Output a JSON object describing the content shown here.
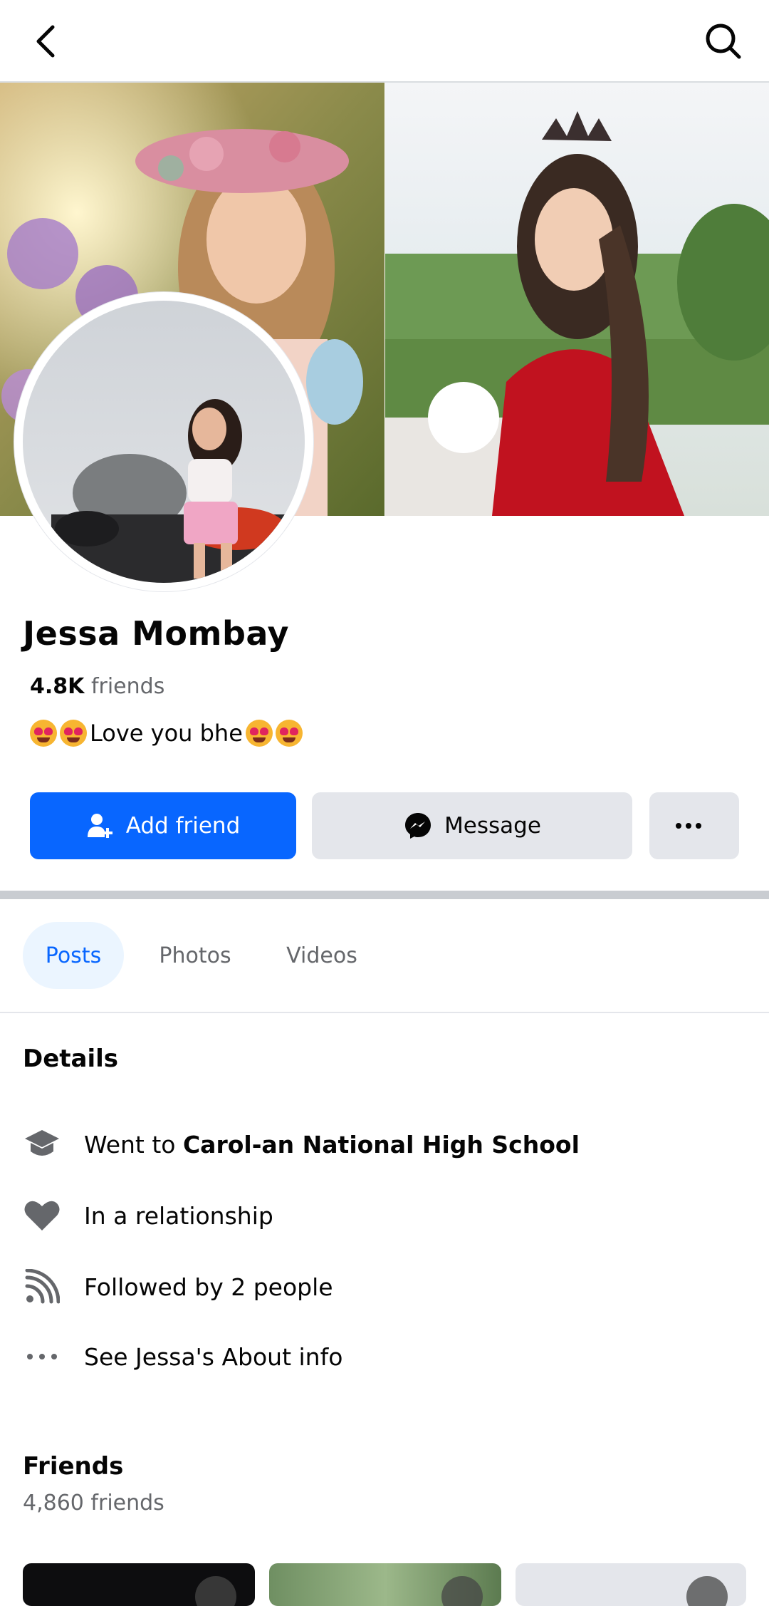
{
  "profile": {
    "name": "Jessa Mombay",
    "friends_count": "4.8K",
    "friends_word": "friends",
    "bio_text": "Love you bhe"
  },
  "actions": {
    "add_friend": "Add friend",
    "message": "Message",
    "more": "···"
  },
  "tabs": [
    {
      "label": "Posts",
      "active": true
    },
    {
      "label": "Photos",
      "active": false
    },
    {
      "label": "Videos",
      "active": false
    }
  ],
  "details": {
    "title": "Details",
    "school_prefix": "Went to ",
    "school_name": "Carol-an National High School",
    "relationship": "In a relationship",
    "followed_by": "Followed by 2 people",
    "about_link": "See Jessa's About info"
  },
  "friends_section": {
    "title": "Friends",
    "count_text": "4,860 friends"
  },
  "icons": {
    "back": "chevron-left-icon",
    "search": "search-icon",
    "add_friend": "add-person-icon",
    "message": "messenger-icon",
    "school": "graduation-cap-icon",
    "relationship": "heart-icon",
    "followers": "rss-icon",
    "more": "ellipsis-icon"
  },
  "colors": {
    "accent": "#0866ff",
    "button_gray": "#e4e6eb",
    "tab_active_bg": "#ebf5ff",
    "secondary_text": "#65676b"
  }
}
